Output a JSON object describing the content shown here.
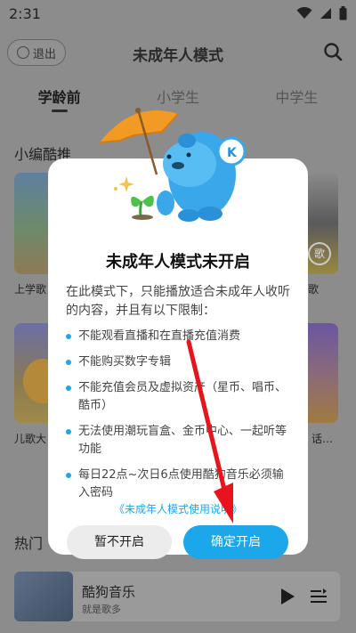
{
  "status_bar": {
    "time": "2:31"
  },
  "header": {
    "exit_label": "退出",
    "title": "未成年人模式"
  },
  "tabs": [
    {
      "label": "学龄前",
      "active": true
    },
    {
      "label": "小学生",
      "active": false
    },
    {
      "label": "中学生",
      "active": false
    }
  ],
  "sections": {
    "editor_picks": "小编酷推",
    "hot": "热门"
  },
  "background_cards": {
    "card1_label": "上学歌",
    "card2_label": "歌",
    "card3_label": "儿歌大",
    "card4_label": "话…",
    "card2_badge": "歌"
  },
  "mini_player": {
    "title": "酷狗音乐",
    "subtitle": "就是歌多"
  },
  "dialog": {
    "title": "未成年人模式未开启",
    "intro": "在此模式下，只能播放适合未成年人收听的内容，并且有以下限制：",
    "rules": [
      "不能观看直播和在直播充值消费",
      "不能购买数字专辑",
      "不能充值会员及虚拟资产（星币、唱币、酷币）",
      "无法使用潮玩盲盒、金币中心、一起听等功能",
      "每日22点~次日6点使用酷狗音乐必须输入密码"
    ],
    "guide_link": "《未成年人模式使用说明》",
    "cancel_label": "暂不开启",
    "confirm_label": "确定开启"
  },
  "colors": {
    "accent": "#1ca7ea",
    "arrow": "#e8141c",
    "dim_background": "#8c8c8c"
  }
}
